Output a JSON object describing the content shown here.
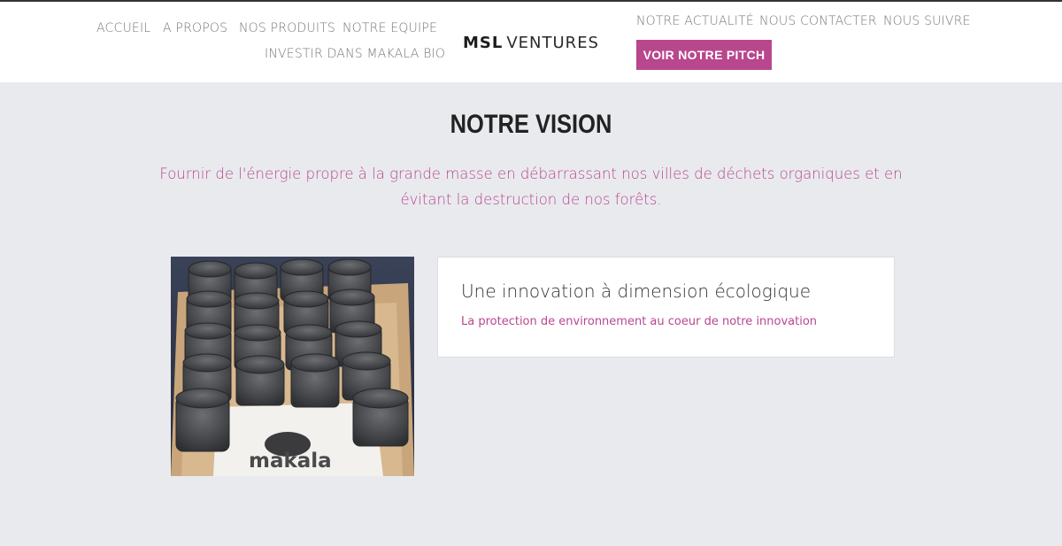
{
  "header": {
    "nav_left": {
      "accueil": "ACCUEIL",
      "apropos": "A PROPOS",
      "produits": "NOS PRODUITS",
      "equipe": "NOTRE EQUIPE",
      "investir": "INVESTIR DANS MAKALA BIO"
    },
    "logo": {
      "bold": "MSL",
      "light": "VENTURES"
    },
    "nav_right": {
      "actualite": "NOTRE ACTUALITÉ",
      "contacter": "NOUS CONTACTER",
      "suivre": "NOUS SUIVRE"
    },
    "pitch_button": "VOIR NOTRE PITCH"
  },
  "vision": {
    "title": "NOTRE VISION",
    "text": "Fournir de l'énergie propre à la grande masse en débarrassant nos villes de déchets organiques et en évitant la destruction de nos forêts."
  },
  "feature": {
    "image_brand": "makala",
    "title": "Une innovation à dimension écologique",
    "subtitle": "La protection de environnement au coeur de notre innovation"
  },
  "colors": {
    "accent": "#b8478d",
    "background": "#e9eaee",
    "header_bg": "#ffffff"
  }
}
